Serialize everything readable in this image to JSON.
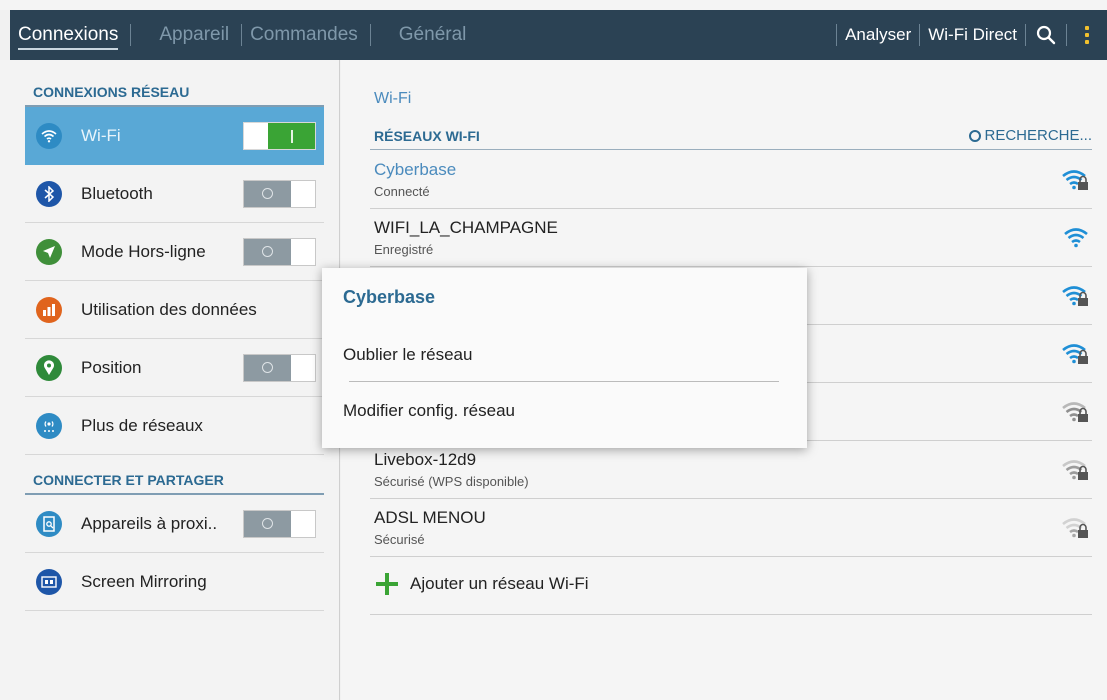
{
  "tabs": [
    {
      "label": "Connexions",
      "active": true
    },
    {
      "label": "Appareil",
      "active": false
    },
    {
      "label": "Commandes",
      "active": false
    },
    {
      "label": "Général",
      "active": false
    }
  ],
  "actions": {
    "analyser": "Analyser",
    "wifi_direct": "Wi-Fi Direct",
    "search_icon": "search-icon",
    "menu_icon": "overflow-menu-icon"
  },
  "left": {
    "section1": "CONNEXIONS RÉSEAU",
    "section2": "CONNECTER ET PARTAGER",
    "items": [
      {
        "label": "Wi-Fi",
        "icon": "wifi-icon",
        "color": "#2e8bc4",
        "toggle": "on"
      },
      {
        "label": "Bluetooth",
        "icon": "bluetooth-icon",
        "color": "#1e56a8",
        "toggle": "off"
      },
      {
        "label": "Mode Hors-ligne",
        "icon": "airplane-icon",
        "color": "#3f8f3a",
        "toggle": "off"
      },
      {
        "label": "Utilisation des données",
        "icon": "data-usage-icon",
        "color": "#e0641d",
        "toggle": "none"
      },
      {
        "label": "Position",
        "icon": "location-icon",
        "color": "#2f8a3a",
        "toggle": "off"
      },
      {
        "label": "Plus de réseaux",
        "icon": "more-networks-icon",
        "color": "#2e8bc4",
        "toggle": "none"
      },
      {
        "label": "Appareils à proxi..",
        "icon": "nearby-devices-icon",
        "color": "#2e8bc4",
        "toggle": "off"
      },
      {
        "label": "Screen Mirroring",
        "icon": "screen-mirroring-icon",
        "color": "#1e56a8",
        "toggle": "none"
      }
    ]
  },
  "right": {
    "title": "Wi-Fi",
    "networks_header": "RÉSEAUX WI-FI",
    "scan_label": "RECHERCHE...",
    "networks": [
      {
        "name": "Cyberbase",
        "status": "Connecté",
        "signal": "strong-locked",
        "connected": true
      },
      {
        "name": "WIFI_LA_CHAMPAGNE",
        "status": "Enregistré",
        "signal": "strong-open",
        "connected": false
      },
      {
        "name": "",
        "status": "",
        "signal": "strong-locked",
        "connected": false
      },
      {
        "name": "",
        "status": "",
        "signal": "strong-locked",
        "connected": false
      },
      {
        "name": "",
        "status": "",
        "signal": "weak-locked",
        "connected": false
      },
      {
        "name": "Livebox-12d9",
        "status": "Sécurisé (WPS disponible)",
        "signal": "weak-locked",
        "connected": false
      },
      {
        "name": "ADSL MENOU",
        "status": "Sécurisé",
        "signal": "weak-locked",
        "connected": false
      }
    ],
    "add_label": "Ajouter un réseau Wi-Fi"
  },
  "dialog": {
    "title": "Cyberbase",
    "forget": "Oublier le réseau",
    "modify": "Modifier config. réseau"
  },
  "colors": {
    "accent": "#2c6a92",
    "topbar": "#2b4254",
    "selected": "#59a8d6",
    "toggle_on": "#3aa435",
    "signal_strong": "#1f8fd6",
    "signal_weak": "#a8a8a8"
  }
}
